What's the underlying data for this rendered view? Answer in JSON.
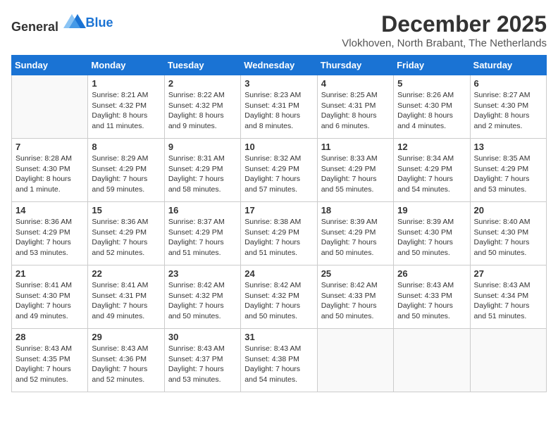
{
  "logo": {
    "general": "General",
    "blue": "Blue"
  },
  "header": {
    "month_year": "December 2025",
    "location": "Vlokhoven, North Brabant, The Netherlands"
  },
  "weekdays": [
    "Sunday",
    "Monday",
    "Tuesday",
    "Wednesday",
    "Thursday",
    "Friday",
    "Saturday"
  ],
  "weeks": [
    [
      {
        "day": "",
        "info": ""
      },
      {
        "day": "1",
        "info": "Sunrise: 8:21 AM\nSunset: 4:32 PM\nDaylight: 8 hours\nand 11 minutes."
      },
      {
        "day": "2",
        "info": "Sunrise: 8:22 AM\nSunset: 4:32 PM\nDaylight: 8 hours\nand 9 minutes."
      },
      {
        "day": "3",
        "info": "Sunrise: 8:23 AM\nSunset: 4:31 PM\nDaylight: 8 hours\nand 8 minutes."
      },
      {
        "day": "4",
        "info": "Sunrise: 8:25 AM\nSunset: 4:31 PM\nDaylight: 8 hours\nand 6 minutes."
      },
      {
        "day": "5",
        "info": "Sunrise: 8:26 AM\nSunset: 4:30 PM\nDaylight: 8 hours\nand 4 minutes."
      },
      {
        "day": "6",
        "info": "Sunrise: 8:27 AM\nSunset: 4:30 PM\nDaylight: 8 hours\nand 2 minutes."
      }
    ],
    [
      {
        "day": "7",
        "info": "Sunrise: 8:28 AM\nSunset: 4:30 PM\nDaylight: 8 hours\nand 1 minute."
      },
      {
        "day": "8",
        "info": "Sunrise: 8:29 AM\nSunset: 4:29 PM\nDaylight: 7 hours\nand 59 minutes."
      },
      {
        "day": "9",
        "info": "Sunrise: 8:31 AM\nSunset: 4:29 PM\nDaylight: 7 hours\nand 58 minutes."
      },
      {
        "day": "10",
        "info": "Sunrise: 8:32 AM\nSunset: 4:29 PM\nDaylight: 7 hours\nand 57 minutes."
      },
      {
        "day": "11",
        "info": "Sunrise: 8:33 AM\nSunset: 4:29 PM\nDaylight: 7 hours\nand 55 minutes."
      },
      {
        "day": "12",
        "info": "Sunrise: 8:34 AM\nSunset: 4:29 PM\nDaylight: 7 hours\nand 54 minutes."
      },
      {
        "day": "13",
        "info": "Sunrise: 8:35 AM\nSunset: 4:29 PM\nDaylight: 7 hours\nand 53 minutes."
      }
    ],
    [
      {
        "day": "14",
        "info": "Sunrise: 8:36 AM\nSunset: 4:29 PM\nDaylight: 7 hours\nand 53 minutes."
      },
      {
        "day": "15",
        "info": "Sunrise: 8:36 AM\nSunset: 4:29 PM\nDaylight: 7 hours\nand 52 minutes."
      },
      {
        "day": "16",
        "info": "Sunrise: 8:37 AM\nSunset: 4:29 PM\nDaylight: 7 hours\nand 51 minutes."
      },
      {
        "day": "17",
        "info": "Sunrise: 8:38 AM\nSunset: 4:29 PM\nDaylight: 7 hours\nand 51 minutes."
      },
      {
        "day": "18",
        "info": "Sunrise: 8:39 AM\nSunset: 4:29 PM\nDaylight: 7 hours\nand 50 minutes."
      },
      {
        "day": "19",
        "info": "Sunrise: 8:39 AM\nSunset: 4:30 PM\nDaylight: 7 hours\nand 50 minutes."
      },
      {
        "day": "20",
        "info": "Sunrise: 8:40 AM\nSunset: 4:30 PM\nDaylight: 7 hours\nand 50 minutes."
      }
    ],
    [
      {
        "day": "21",
        "info": "Sunrise: 8:41 AM\nSunset: 4:30 PM\nDaylight: 7 hours\nand 49 minutes."
      },
      {
        "day": "22",
        "info": "Sunrise: 8:41 AM\nSunset: 4:31 PM\nDaylight: 7 hours\nand 49 minutes."
      },
      {
        "day": "23",
        "info": "Sunrise: 8:42 AM\nSunset: 4:32 PM\nDaylight: 7 hours\nand 50 minutes."
      },
      {
        "day": "24",
        "info": "Sunrise: 8:42 AM\nSunset: 4:32 PM\nDaylight: 7 hours\nand 50 minutes."
      },
      {
        "day": "25",
        "info": "Sunrise: 8:42 AM\nSunset: 4:33 PM\nDaylight: 7 hours\nand 50 minutes."
      },
      {
        "day": "26",
        "info": "Sunrise: 8:43 AM\nSunset: 4:33 PM\nDaylight: 7 hours\nand 50 minutes."
      },
      {
        "day": "27",
        "info": "Sunrise: 8:43 AM\nSunset: 4:34 PM\nDaylight: 7 hours\nand 51 minutes."
      }
    ],
    [
      {
        "day": "28",
        "info": "Sunrise: 8:43 AM\nSunset: 4:35 PM\nDaylight: 7 hours\nand 52 minutes."
      },
      {
        "day": "29",
        "info": "Sunrise: 8:43 AM\nSunset: 4:36 PM\nDaylight: 7 hours\nand 52 minutes."
      },
      {
        "day": "30",
        "info": "Sunrise: 8:43 AM\nSunset: 4:37 PM\nDaylight: 7 hours\nand 53 minutes."
      },
      {
        "day": "31",
        "info": "Sunrise: 8:43 AM\nSunset: 4:38 PM\nDaylight: 7 hours\nand 54 minutes."
      },
      {
        "day": "",
        "info": ""
      },
      {
        "day": "",
        "info": ""
      },
      {
        "day": "",
        "info": ""
      }
    ]
  ]
}
